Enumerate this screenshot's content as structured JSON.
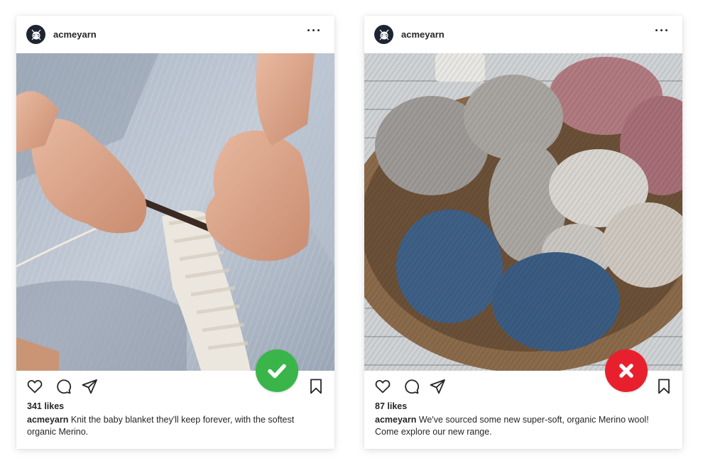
{
  "posts": [
    {
      "username": "acmeyarn",
      "more_label": "···",
      "photo_subject": "hands knitting white yarn",
      "likes": "341 likes",
      "caption_user": "acmeyarn",
      "caption_text": " Knit the baby blanket they'll keep forever, with the softest organic Merino.",
      "badge": {
        "type": "check",
        "color": "#3ab54a"
      }
    },
    {
      "username": "acmeyarn",
      "more_label": "···",
      "photo_subject": "basket of yarn skeins",
      "likes": "87 likes",
      "caption_user": "acmeyarn",
      "caption_text": " We've sourced some new super-soft, organic Merino wool! Come explore our new range.",
      "badge": {
        "type": "cross",
        "color": "#e8202e"
      }
    }
  ],
  "icons": [
    "heart-icon",
    "comment-icon",
    "share-icon",
    "bookmark-icon",
    "ellipsis-icon",
    "logo-icon"
  ]
}
